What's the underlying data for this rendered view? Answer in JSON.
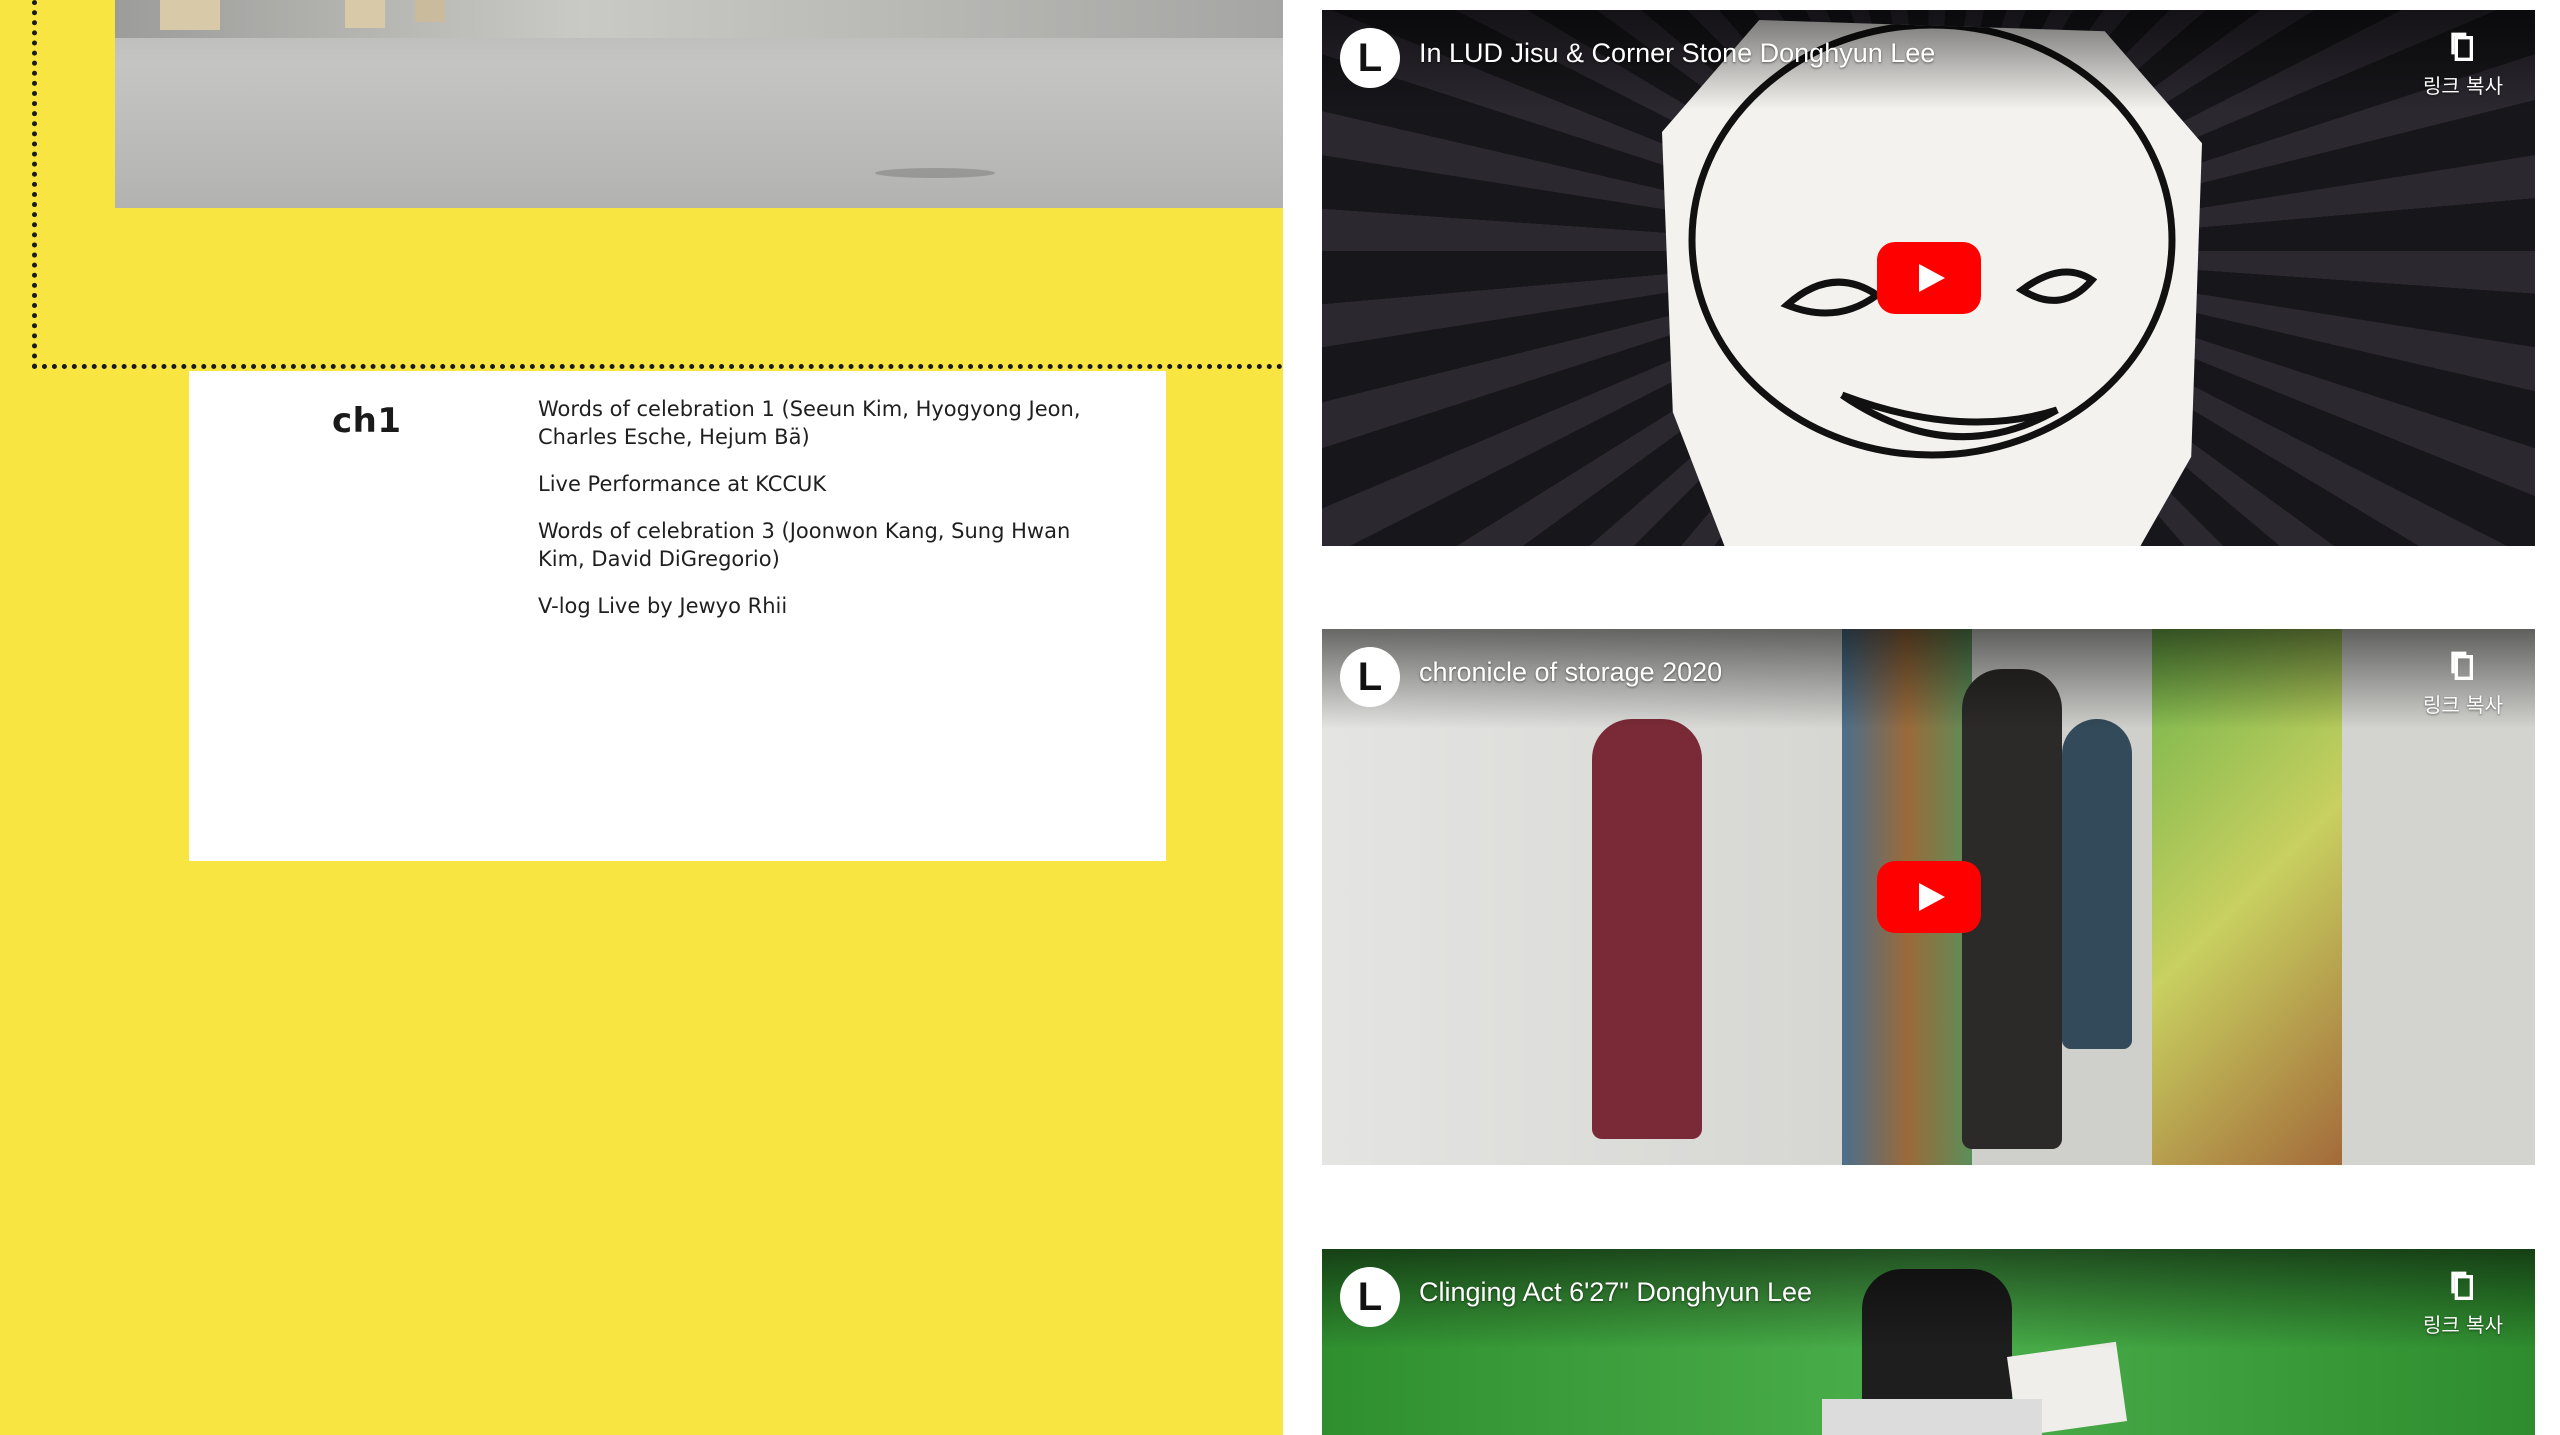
{
  "schedule": {
    "channel": "ch1",
    "items": [
      "Words of celebration 1 (Seeun Kim, Hyogyong Jeon, Charles Esche, Hejum Bä)",
      "Live Performance at KCCUK",
      "Words of celebration 3 (Joonwon Kang, Sung Hwan Kim, David DiGregorio)",
      "V-log Live by Jewyo Rhii"
    ]
  },
  "videos": [
    {
      "title": "In LUD Jisu & Corner Stone Donghyun Lee",
      "channel_logo": "L",
      "copy_label": "링크 복사"
    },
    {
      "title": "chronicle of storage 2020",
      "channel_logo": "L",
      "copy_label": "링크 복사"
    },
    {
      "title": "Clinging Act 6'27\" Donghyun Lee",
      "channel_logo": "L",
      "copy_label": "링크 복사"
    }
  ],
  "colors": {
    "panel_yellow": "#f8e541",
    "play_red": "#ff0000"
  },
  "icons": {
    "copy": "copy-link-icon",
    "play": "youtube-play-icon"
  }
}
